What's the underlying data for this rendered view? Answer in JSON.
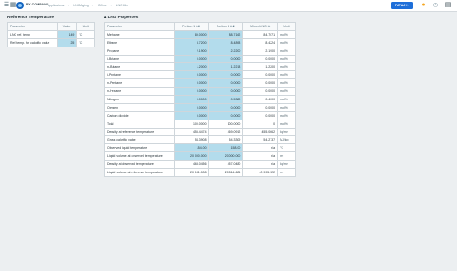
{
  "topbar": {
    "menu_icon": "☰",
    "grid_icon": "▦",
    "company": "MY COMPANY",
    "breadcrumb": [
      "Applications",
      "LNG Aging",
      "Offline",
      "LNG Mix"
    ],
    "user_button": "PAPAJ I ▾",
    "pin_icon": "●",
    "history_icon": "◷",
    "doc_icon": "▤"
  },
  "ref_panel": {
    "title": "Reference Temperature",
    "headers": [
      "Parameter",
      "Value",
      "Unit"
    ],
    "rows": [
      {
        "param": "LNG ref. temp",
        "value": "149",
        "unit": "°C"
      },
      {
        "param": "Ref. temp. for calorific value",
        "value": "25",
        "unit": "°C"
      }
    ]
  },
  "lng_panel": {
    "title": "LNG Properties",
    "headers": [
      "Parameter",
      "Portion 1",
      "Portion 2",
      "Mixed LNG",
      "Unit"
    ],
    "rows": [
      {
        "param": "Methane",
        "p1": "89.0000",
        "p2": "88.7162",
        "mix": "84.7071",
        "unit": "mol%"
      },
      {
        "param": "Ethane",
        "p1": "8.7200",
        "p2": "8.4898",
        "mix": "8.4224",
        "unit": "mol%"
      },
      {
        "param": "Propane",
        "p1": "2.1900",
        "p2": "2.2200",
        "mix": "2.1900",
        "unit": "mol%"
      },
      {
        "param": "i-Butane",
        "p1": "0.0000",
        "p2": "0.0000",
        "mix": "0.0000",
        "unit": "mol%"
      },
      {
        "param": "n-Butane",
        "p1": "1.2000",
        "p2": "1.2218",
        "mix": "1.2200",
        "unit": "mol%"
      },
      {
        "param": "i-Pentane",
        "p1": "0.0000",
        "p2": "0.0000",
        "mix": "0.0000",
        "unit": "mol%"
      },
      {
        "param": "n-Pentane",
        "p1": "0.0000",
        "p2": "0.0000",
        "mix": "0.0000",
        "unit": "mol%"
      },
      {
        "param": "n-Hexane",
        "p1": "0.0000",
        "p2": "0.0000",
        "mix": "0.0000",
        "unit": "mol%"
      },
      {
        "param": "Nitrogen",
        "p1": "0.0000",
        "p2": "0.5380",
        "mix": "0.4000",
        "unit": "mol%"
      },
      {
        "param": "Oxygen",
        "p1": "0.0000",
        "p2": "0.0000",
        "mix": "0.0000",
        "unit": "mol%"
      },
      {
        "param": "Carbon dioxide",
        "p1": "0.0000",
        "p2": "0.0000",
        "mix": "0.0000",
        "unit": "mol%"
      },
      {
        "param": "Total",
        "p1": "100.0000",
        "p2": "100.0000",
        "mix": "0",
        "unit": "mol%"
      },
      {
        "param": "Density at reference temperature",
        "p1": "455.4474",
        "p2": "469.0912",
        "mix": "455.0662",
        "unit": "kg/m³"
      },
      {
        "param": "Gross calorific value",
        "p1": "54.3908",
        "p2": "54.3309",
        "mix": "54.2737",
        "unit": "MJ/kg"
      },
      {
        "param": "Observed liquid temperature",
        "p1": "154.00",
        "p2": "158.00",
        "mix": "n/a",
        "unit": "°C"
      },
      {
        "param": "Liquid volume at observed temperature",
        "p1": "20 000.000",
        "p2": "20 000.000",
        "mix": "n/a",
        "unit": "m³"
      },
      {
        "param": "Density at observed temperature",
        "p1": "463.0456",
        "p2": "457.0480",
        "mix": "n/a",
        "unit": "kg/m³"
      },
      {
        "param": "Liquid volume at reference temperature",
        "p1": "20 181.008",
        "p2": "20 814.624",
        "mix": "40 995.922",
        "unit": "m³"
      }
    ],
    "highlight_rows": {
      "composition_end": 11,
      "observed_start": 14,
      "observed_end": 16
    }
  },
  "colors": {
    "accent": "#1e6fd9",
    "highlight_cell": "#b3dcec",
    "background": "#eceff1"
  }
}
